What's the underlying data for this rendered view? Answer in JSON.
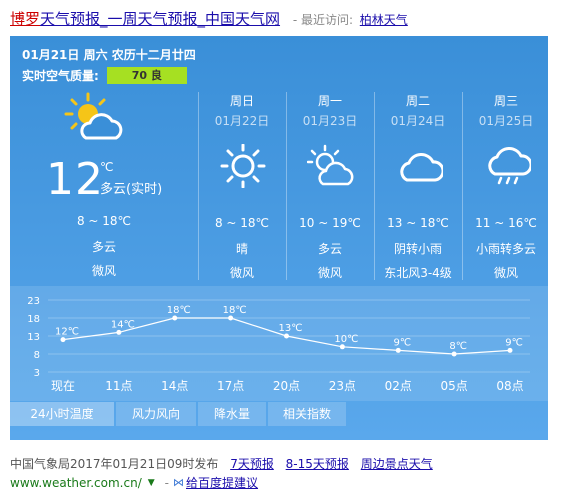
{
  "title": {
    "city": "博罗",
    "rest": "天气预报_一周天气预报_中国天气网",
    "recent_label": "- 最近访问:",
    "recent_city": "柏林天气"
  },
  "today": {
    "date": "01月21日 周六 农历十二月廿四",
    "aqi_label": "实时空气质量:",
    "aqi_value": "70 良",
    "temp": "12",
    "unit": "℃",
    "desc": "多云(实时)",
    "range": "8 ~ 18℃",
    "cond": "多云",
    "wind": "微风",
    "icon": "partly-cloudy-icon"
  },
  "forecast": [
    {
      "day": "周日",
      "date": "01月22日",
      "icon": "sun-icon",
      "range": "8 ~ 18℃",
      "cond": "晴",
      "wind": "微风"
    },
    {
      "day": "周一",
      "date": "01月23日",
      "icon": "partly-cloudy-icon",
      "range": "10 ~ 19℃",
      "cond": "多云",
      "wind": "微风"
    },
    {
      "day": "周二",
      "date": "01月24日",
      "icon": "cloud-icon",
      "range": "13 ~ 18℃",
      "cond": "阴转小雨",
      "wind": "东北风3-4级"
    },
    {
      "day": "周三",
      "date": "01月25日",
      "icon": "rain-cloud-icon",
      "range": "11 ~ 16℃",
      "cond": "小雨转多云",
      "wind": "微风"
    }
  ],
  "chart_data": {
    "type": "line",
    "categories": [
      "现在",
      "11点",
      "14点",
      "17点",
      "20点",
      "23点",
      "02点",
      "05点",
      "08点"
    ],
    "series": [
      {
        "values": [
          12,
          14,
          18,
          18,
          13,
          10,
          9,
          8,
          9
        ]
      }
    ],
    "data_labels": [
      "12℃",
      "14℃",
      "18℃",
      "18℃",
      "13℃",
      "10℃",
      "9℃",
      "8℃",
      "9℃"
    ],
    "y_ticks": [
      "23",
      "18",
      "13",
      "8",
      "3"
    ],
    "ylim": [
      3,
      23
    ],
    "grid": true
  },
  "tabs": [
    "24小时温度",
    "风力风向",
    "降水量",
    "相关指数"
  ],
  "footer": {
    "source": "中国气象局2017年01月21日09时发布",
    "links": [
      "7天预报",
      "8-15天预报",
      "周边景点天气"
    ],
    "url": "www.weather.com.cn/",
    "feedback": "给百度提建议"
  },
  "colors": {
    "card_top": "#3a8fd8",
    "card_bottom": "#5aa8ec",
    "aqi_good": "#a6e022",
    "sun": "#f5c518"
  }
}
